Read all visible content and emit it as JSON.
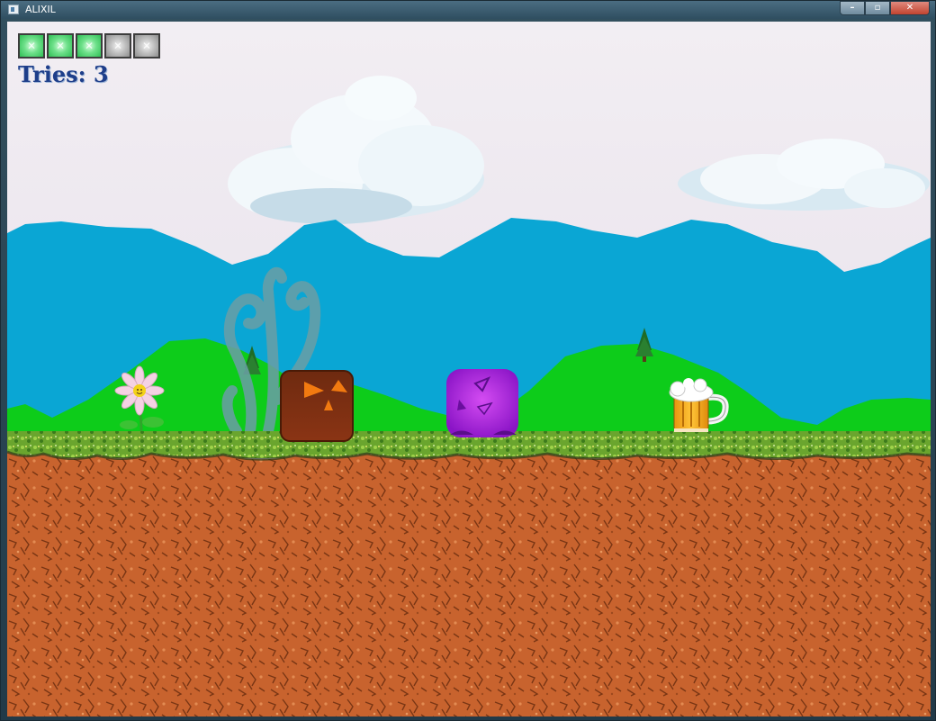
{
  "window": {
    "title": "ALIXIL",
    "controls": {
      "minimize": "–",
      "maximize": "▫",
      "close": "✕"
    }
  },
  "hud": {
    "health": {
      "filled": 3,
      "total": 5
    },
    "tries": "Tries: 3"
  },
  "scene": {
    "sprites": [
      "cloud",
      "cloud",
      "mountains",
      "green-hills",
      "twisted-tree",
      "daisy-flower",
      "brown-block-enemy",
      "purple-blob-player",
      "beer-mug-pickup",
      "pine-tree",
      "grass-ground",
      "dirt-ground"
    ]
  },
  "colors": {
    "sky": "#ece5ee",
    "mountain": "#0aa6d4",
    "hill": "#0dcc1a",
    "dirt": "#c8632e",
    "grass": "#5f9a2a",
    "enemy": "#7a2a0c",
    "player": "#a020d8",
    "hud_text": "#1e3e8a",
    "health_on": "#2fbf55",
    "health_off": "#9a9a9a"
  }
}
